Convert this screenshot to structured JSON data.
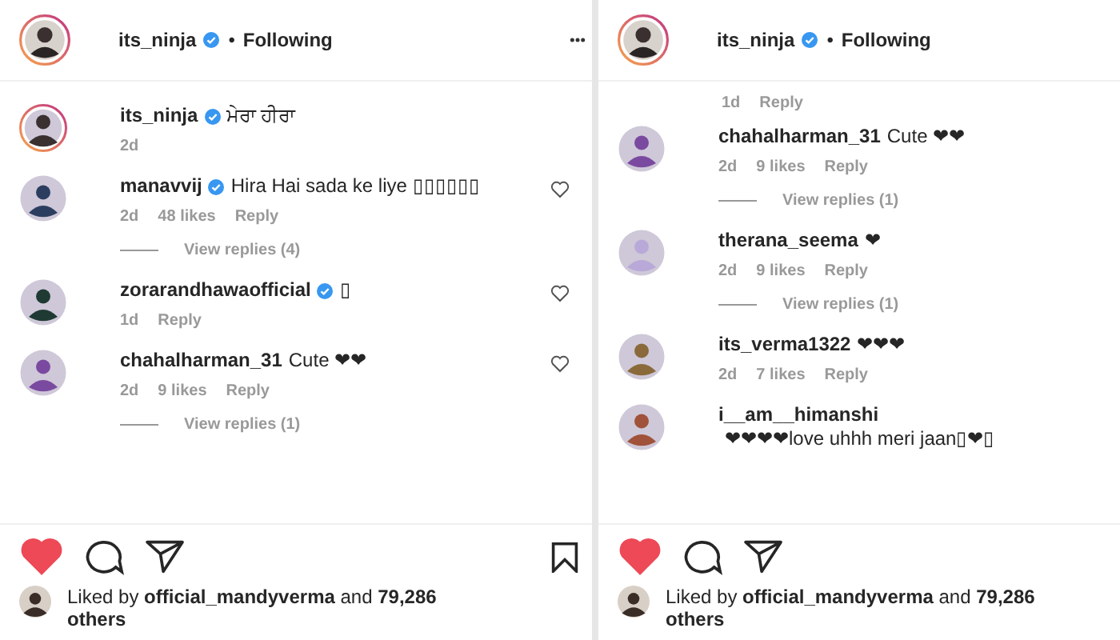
{
  "panels": [
    {
      "header": {
        "user": "its_ninja",
        "verified": true,
        "separator": "•",
        "follow": "Following",
        "more_icon": true
      },
      "like_column": true,
      "comments": [
        {
          "user": "its_ninja",
          "verified": true,
          "story_ring": true,
          "text": "ਮੇਰਾ ਹੀਰਾ",
          "time": "2d"
        },
        {
          "user": "manavvij",
          "verified": true,
          "story_ring": false,
          "text": "Hira Hai sada ke liye ▯▯▯▯▯▯",
          "time": "2d",
          "likes": "48 likes",
          "reply": "Reply",
          "view_replies": "View replies (4)"
        },
        {
          "user": "zorarandhawaofficial",
          "verified": true,
          "story_ring": false,
          "text": "▯",
          "time": "1d",
          "reply": "Reply"
        },
        {
          "user": "chahalharman_31",
          "verified": false,
          "story_ring": false,
          "text": "Cute ❤❤",
          "time": "2d",
          "likes": "9 likes",
          "reply": "Reply",
          "view_replies": "View replies (1)"
        }
      ],
      "footer": {
        "liked": true,
        "bookmark": true,
        "liked_by": "Liked by **official_mandyverma** and **79,286 others**"
      }
    },
    {
      "header": {
        "user": "its_ninja",
        "verified": true,
        "separator": "•",
        "follow": "Following",
        "more_icon": false
      },
      "like_column": false,
      "partial_meta": {
        "time": "1d",
        "reply": "Reply"
      },
      "comments": [
        {
          "user": "chahalharman_31",
          "verified": false,
          "story_ring": false,
          "text": "Cute ❤❤",
          "time": "2d",
          "likes": "9 likes",
          "reply": "Reply",
          "view_replies": "View replies (1)"
        },
        {
          "user": "therana_seema",
          "verified": false,
          "story_ring": false,
          "text": "❤",
          "time": "2d",
          "likes": "9 likes",
          "reply": "Reply",
          "view_replies": "View replies (1)"
        },
        {
          "user": "its_verma1322",
          "verified": false,
          "story_ring": false,
          "text": "❤❤❤",
          "time": "2d",
          "likes": "7 likes",
          "reply": "Reply"
        },
        {
          "user": "i__am__himanshi",
          "verified": false,
          "story_ring": false,
          "text": "❤❤❤❤love uhhh meri jaan▯❤▯"
        }
      ],
      "footer": {
        "liked": true,
        "bookmark": false,
        "liked_by": "Liked by **official_mandyverma** and **79,286 others**"
      }
    }
  ]
}
